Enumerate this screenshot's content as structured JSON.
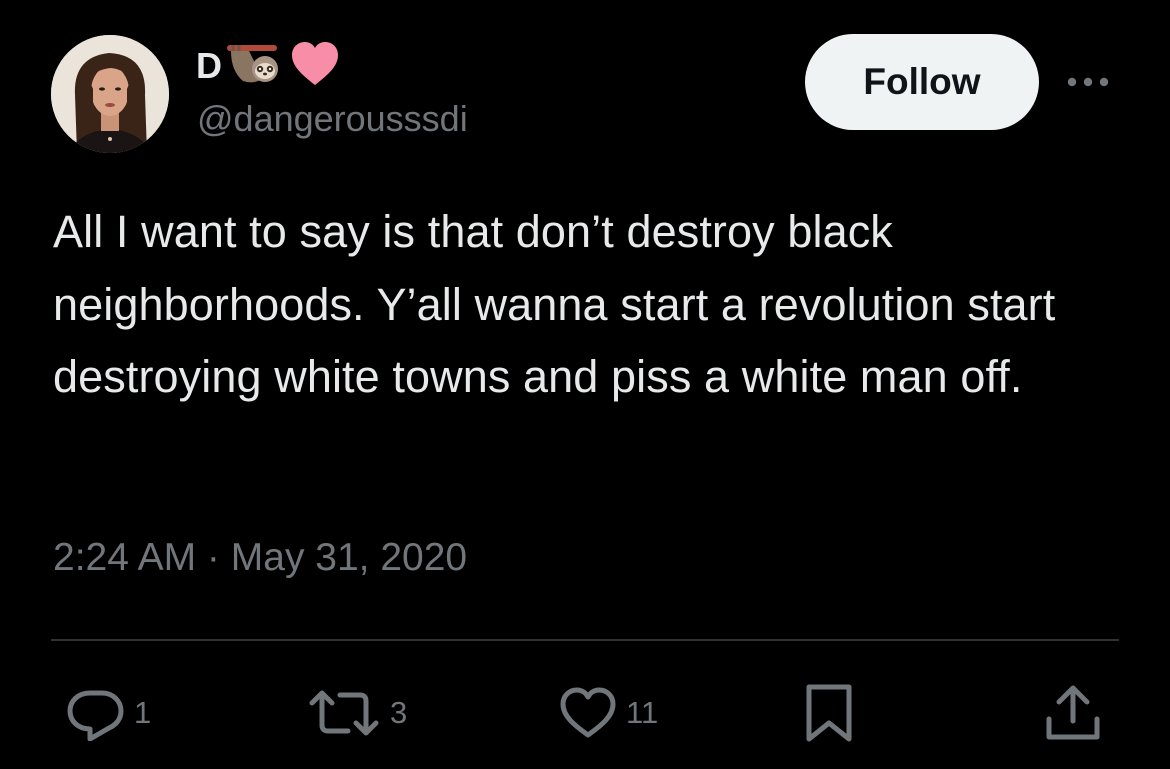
{
  "user": {
    "display_name": "D",
    "display_name_emojis": [
      "sloth-emoji",
      "pink-heart-emoji"
    ],
    "handle": "@dangerousssdi",
    "avatar": "profile-photo-avatar"
  },
  "header": {
    "follow_label": "Follow",
    "more_icon": "more-horizontal-icon"
  },
  "tweet": {
    "text": "All I want to say is that don’t destroy black neighborhoods. Y’all wanna start a revolution start destroying white towns and piss a white man off.",
    "time": "2:24 AM",
    "separator": " · ",
    "date": "May 31, 2020"
  },
  "actions": {
    "reply": {
      "icon": "reply-icon",
      "count": "1"
    },
    "retweet": {
      "icon": "retweet-icon",
      "count": "3"
    },
    "like": {
      "icon": "heart-icon",
      "count": "11"
    },
    "bookmark": {
      "icon": "bookmark-icon"
    },
    "share": {
      "icon": "share-icon"
    }
  },
  "colors": {
    "background": "#000000",
    "primary_text": "#e7e9ea",
    "secondary_text": "#71767b",
    "divider": "#2f3336",
    "follow_button_bg": "#eff3f4",
    "heart_emoji": "#f78da7"
  }
}
